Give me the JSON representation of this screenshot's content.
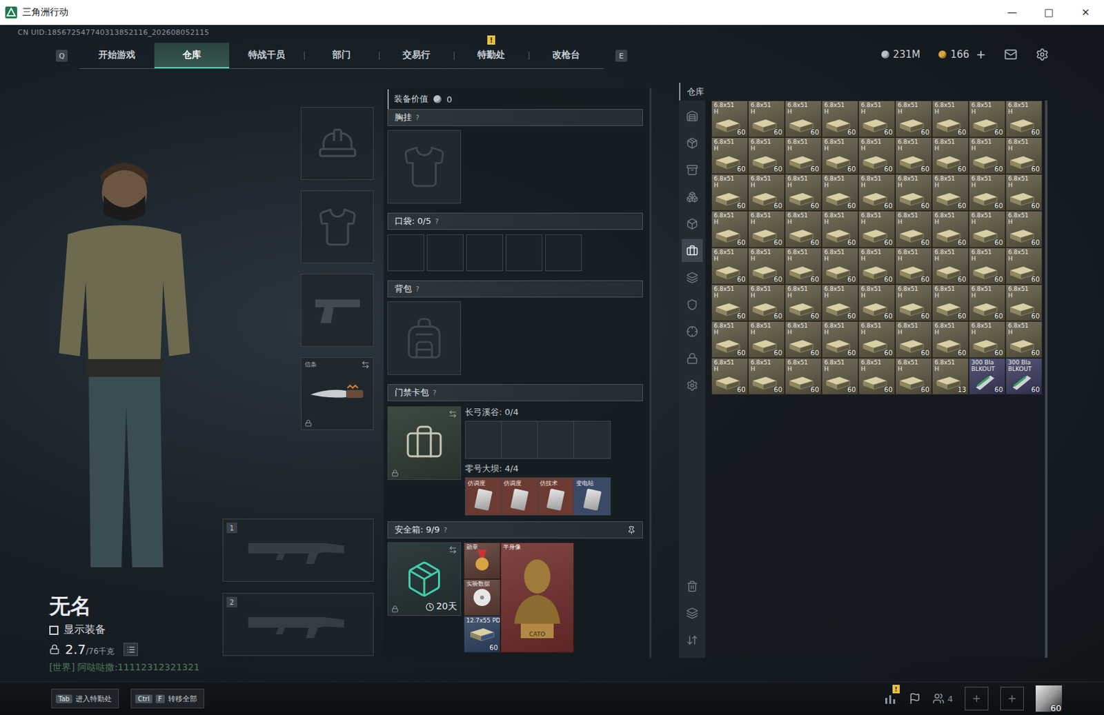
{
  "window": {
    "title": "三角洲行动",
    "controls": [
      "—",
      "□",
      "✕"
    ]
  },
  "uid": "CN UID:185672547740313852116_202608052115",
  "nav": {
    "prev_key": "Q",
    "next_key": "E",
    "tabs": [
      {
        "label": "开始游戏",
        "selected": false,
        "badge": ""
      },
      {
        "label": "仓库",
        "selected": true,
        "badge": ""
      },
      {
        "label": "特战干员",
        "selected": false,
        "badge": ""
      },
      {
        "label": "部门",
        "selected": false,
        "badge": ""
      },
      {
        "label": "交易行",
        "selected": false,
        "badge": ""
      },
      {
        "label": "特勤处",
        "selected": false,
        "badge": "!"
      },
      {
        "label": "改枪台",
        "selected": false,
        "badge": ""
      }
    ]
  },
  "currency": [
    {
      "amount": "231M",
      "color": "#b9bec4",
      "plus": ""
    },
    {
      "amount": "166",
      "color": "#d9a441",
      "plus": "+"
    }
  ],
  "player": {
    "name": "无名",
    "show_equipment": {
      "label": "显示装备",
      "checked": false
    },
    "weight": "2.7",
    "weight_max": "/76千克"
  },
  "chat": {
    "channel": "[世界]",
    "text": "阿哒哒撒:11112312321321"
  },
  "gear": {
    "slots": [
      {
        "kind": "helmet",
        "label": "",
        "locked": false
      },
      {
        "kind": "armor",
        "label": "",
        "locked": false
      },
      {
        "kind": "pistol",
        "label": "",
        "locked": false
      },
      {
        "kind": "melee",
        "label": "信条",
        "locked": true
      }
    ],
    "weapons": [
      {
        "number": "1"
      },
      {
        "number": "2"
      }
    ]
  },
  "loadout": {
    "value_label": "装备价值",
    "value": "0",
    "chest": {
      "title": "胸挂",
      "help": "?"
    },
    "pockets": {
      "title": "口袋: 0/5",
      "help": "?",
      "slots": [
        {
          "filled": false
        },
        {
          "filled": false
        },
        {
          "filled": false
        },
        {
          "filled": false
        },
        {
          "filled": false
        }
      ]
    },
    "backpack": {
      "title": "背包",
      "help": "?"
    },
    "keycards": {
      "title": "门禁卡包",
      "help": "?",
      "locked": true,
      "maps": [
        {
          "name": "长弓溪谷: 0/4",
          "cards": [
            {
              "filled": false,
              "label": "",
              "color": "#252c32"
            },
            {
              "filled": false,
              "label": "",
              "color": "#252c32"
            },
            {
              "filled": false,
              "label": "",
              "color": "#252c32"
            },
            {
              "filled": false,
              "label": "",
              "color": "#252c32"
            }
          ]
        },
        {
          "name": "零号大坝: 4/4",
          "cards": [
            {
              "filled": true,
              "label": "仿调度",
              "color": "#6b3a32"
            },
            {
              "filled": true,
              "label": "仿调度",
              "color": "#6b3a32"
            },
            {
              "filled": true,
              "label": "仿技术",
              "color": "#6b3a32"
            },
            {
              "filled": true,
              "label": "变电站",
              "color": "#3a4a66"
            }
          ]
        }
      ]
    },
    "safebox": {
      "title": "安全箱: 9/9",
      "help": "?",
      "timer": "20天",
      "locked": true,
      "items": [
        {
          "label": "勋章",
          "count": "",
          "kind": "small",
          "color": "#5b3b33",
          "caption": ""
        },
        {
          "label": "半身像",
          "count": "",
          "kind": "bust",
          "color": "#6e2b2b",
          "caption": "CATO"
        },
        {
          "label": "实验数据",
          "count": "",
          "kind": "small",
          "color": "#5b3b33",
          "caption": ""
        },
        {
          "label": "12.7x55 PD",
          "count": "60",
          "kind": "small",
          "color": "#2e4160",
          "caption": ""
        }
      ]
    }
  },
  "warehouse": {
    "title": "仓库",
    "sidebar": {
      "top": [
        {
          "selected": false
        },
        {
          "selected": false
        },
        {
          "selected": false
        },
        {
          "selected": false
        },
        {
          "selected": false
        },
        {
          "selected": true
        },
        {
          "selected": false
        },
        {
          "selected": false
        },
        {
          "selected": false
        },
        {
          "selected": false
        },
        {
          "selected": false
        }
      ],
      "bottom": [
        {
          "selected": false
        },
        {
          "selected": false
        },
        {
          "selected": false
        }
      ]
    },
    "items": [
      {
        "name": "6.8x51",
        "sub": "H",
        "count": "60",
        "color": "#5e5842",
        "kind": "box"
      },
      {
        "name": "6.8x51",
        "sub": "H",
        "count": "60",
        "color": "#5e5842",
        "kind": "box"
      },
      {
        "name": "6.8x51",
        "sub": "H",
        "count": "60",
        "color": "#5e5842",
        "kind": "box"
      },
      {
        "name": "6.8x51",
        "sub": "H",
        "count": "60",
        "color": "#5e5842",
        "kind": "box"
      },
      {
        "name": "6.8x51",
        "sub": "H",
        "count": "60",
        "color": "#5e5842",
        "kind": "box"
      },
      {
        "name": "6.8x51",
        "sub": "H",
        "count": "60",
        "color": "#5e5842",
        "kind": "box"
      },
      {
        "name": "6.8x51",
        "sub": "H",
        "count": "60",
        "color": "#5e5842",
        "kind": "box"
      },
      {
        "name": "6.8x51",
        "sub": "H",
        "count": "60",
        "color": "#5e5842",
        "kind": "box"
      },
      {
        "name": "6.8x51",
        "sub": "H",
        "count": "60",
        "color": "#5e5842",
        "kind": "box"
      },
      {
        "name": "6.8x51",
        "sub": "H",
        "count": "60",
        "color": "#5e5842",
        "kind": "box"
      },
      {
        "name": "6.8x51",
        "sub": "H",
        "count": "60",
        "color": "#5e5842",
        "kind": "box"
      },
      {
        "name": "6.8x51",
        "sub": "H",
        "count": "60",
        "color": "#5e5842",
        "kind": "box"
      },
      {
        "name": "6.8x51",
        "sub": "H",
        "count": "60",
        "color": "#5e5842",
        "kind": "box"
      },
      {
        "name": "6.8x51",
        "sub": "H",
        "count": "60",
        "color": "#5e5842",
        "kind": "box"
      },
      {
        "name": "6.8x51",
        "sub": "H",
        "count": "60",
        "color": "#5e5842",
        "kind": "box"
      },
      {
        "name": "6.8x51",
        "sub": "H",
        "count": "60",
        "color": "#5e5842",
        "kind": "box"
      },
      {
        "name": "6.8x51",
        "sub": "H",
        "count": "60",
        "color": "#5e5842",
        "kind": "box"
      },
      {
        "name": "6.8x51",
        "sub": "H",
        "count": "60",
        "color": "#5e5842",
        "kind": "box"
      },
      {
        "name": "6.8x51",
        "sub": "H",
        "count": "60",
        "color": "#5e5842",
        "kind": "box"
      },
      {
        "name": "6.8x51",
        "sub": "H",
        "count": "60",
        "color": "#5e5842",
        "kind": "box"
      },
      {
        "name": "6.8x51",
        "sub": "H",
        "count": "60",
        "color": "#5e5842",
        "kind": "box"
      },
      {
        "name": "6.8x51",
        "sub": "H",
        "count": "60",
        "color": "#5e5842",
        "kind": "box"
      },
      {
        "name": "6.8x51",
        "sub": "H",
        "count": "60",
        "color": "#5e5842",
        "kind": "box"
      },
      {
        "name": "6.8x51",
        "sub": "H",
        "count": "60",
        "color": "#5e5842",
        "kind": "box"
      },
      {
        "name": "6.8x51",
        "sub": "H",
        "count": "60",
        "color": "#5e5842",
        "kind": "box"
      },
      {
        "name": "6.8x51",
        "sub": "H",
        "count": "60",
        "color": "#5e5842",
        "kind": "box"
      },
      {
        "name": "6.8x51",
        "sub": "H",
        "count": "60",
        "color": "#5e5842",
        "kind": "box"
      },
      {
        "name": "6.8x51",
        "sub": "H",
        "count": "60",
        "color": "#5e5842",
        "kind": "box"
      },
      {
        "name": "6.8x51",
        "sub": "H",
        "count": "60",
        "color": "#5e5842",
        "kind": "box"
      },
      {
        "name": "6.8x51",
        "sub": "H",
        "count": "60",
        "color": "#5e5842",
        "kind": "box"
      },
      {
        "name": "6.8x51",
        "sub": "H",
        "count": "60",
        "color": "#5e5842",
        "kind": "box"
      },
      {
        "name": "6.8x51",
        "sub": "H",
        "count": "60",
        "color": "#5e5842",
        "kind": "box"
      },
      {
        "name": "6.8x51",
        "sub": "H",
        "count": "60",
        "color": "#5e5842",
        "kind": "box"
      },
      {
        "name": "6.8x51",
        "sub": "H",
        "count": "60",
        "color": "#5e5842",
        "kind": "box"
      },
      {
        "name": "6.8x51",
        "sub": "H",
        "count": "60",
        "color": "#5e5842",
        "kind": "box"
      },
      {
        "name": "6.8x51",
        "sub": "H",
        "count": "60",
        "color": "#5e5842",
        "kind": "box"
      },
      {
        "name": "6.8x51",
        "sub": "H",
        "count": "60",
        "color": "#5e5842",
        "kind": "box"
      },
      {
        "name": "6.8x51",
        "sub": "H",
        "count": "60",
        "color": "#5e5842",
        "kind": "box"
      },
      {
        "name": "6.8x51",
        "sub": "H",
        "count": "60",
        "color": "#5e5842",
        "kind": "box"
      },
      {
        "name": "6.8x51",
        "sub": "H",
        "count": "60",
        "color": "#5e5842",
        "kind": "box"
      },
      {
        "name": "6.8x51",
        "sub": "H",
        "count": "60",
        "color": "#5e5842",
        "kind": "box"
      },
      {
        "name": "6.8x51",
        "sub": "H",
        "count": "60",
        "color": "#5e5842",
        "kind": "box"
      },
      {
        "name": "6.8x51",
        "sub": "H",
        "count": "60",
        "color": "#5e5842",
        "kind": "box"
      },
      {
        "name": "6.8x51",
        "sub": "H",
        "count": "60",
        "color": "#5e5842",
        "kind": "box"
      },
      {
        "name": "6.8x51",
        "sub": "H",
        "count": "60",
        "color": "#5e5842",
        "kind": "box"
      },
      {
        "name": "6.8x51",
        "sub": "H",
        "count": "60",
        "color": "#5e5842",
        "kind": "box"
      },
      {
        "name": "6.8x51",
        "sub": "H",
        "count": "60",
        "color": "#5e5842",
        "kind": "box"
      },
      {
        "name": "6.8x51",
        "sub": "H",
        "count": "60",
        "color": "#5e5842",
        "kind": "box"
      },
      {
        "name": "6.8x51",
        "sub": "H",
        "count": "60",
        "color": "#5e5842",
        "kind": "box"
      },
      {
        "name": "6.8x51",
        "sub": "H",
        "count": "60",
        "color": "#5e5842",
        "kind": "box"
      },
      {
        "name": "6.8x51",
        "sub": "H",
        "count": "60",
        "color": "#5e5842",
        "kind": "box"
      },
      {
        "name": "6.8x51",
        "sub": "H",
        "count": "60",
        "color": "#5e5842",
        "kind": "box"
      },
      {
        "name": "6.8x51",
        "sub": "H",
        "count": "60",
        "color": "#5e5842",
        "kind": "box"
      },
      {
        "name": "6.8x51",
        "sub": "H",
        "count": "60",
        "color": "#5e5842",
        "kind": "box"
      },
      {
        "name": "6.8x51",
        "sub": "H",
        "count": "60",
        "color": "#5e5842",
        "kind": "box"
      },
      {
        "name": "6.8x51",
        "sub": "H",
        "count": "60",
        "color": "#5e5842",
        "kind": "box"
      },
      {
        "name": "6.8x51",
        "sub": "H",
        "count": "60",
        "color": "#5e5842",
        "kind": "box"
      },
      {
        "name": "6.8x51",
        "sub": "H",
        "count": "60",
        "color": "#5e5842",
        "kind": "box"
      },
      {
        "name": "6.8x51",
        "sub": "H",
        "count": "60",
        "color": "#5e5842",
        "kind": "box"
      },
      {
        "name": "6.8x51",
        "sub": "H",
        "count": "60",
        "color": "#5e5842",
        "kind": "box"
      },
      {
        "name": "6.8x51",
        "sub": "H",
        "count": "60",
        "color": "#5e5842",
        "kind": "box"
      },
      {
        "name": "6.8x51",
        "sub": "H",
        "count": "60",
        "color": "#5e5842",
        "kind": "box"
      },
      {
        "name": "6.8x51",
        "sub": "H",
        "count": "60",
        "color": "#5e5842",
        "kind": "box"
      },
      {
        "name": "6.8x51",
        "sub": "H",
        "count": "60",
        "color": "#5e5842",
        "kind": "box"
      },
      {
        "name": "6.8x51",
        "sub": "H",
        "count": "60",
        "color": "#5e5842",
        "kind": "box"
      },
      {
        "name": "6.8x51",
        "sub": "H",
        "count": "60",
        "color": "#5e5842",
        "kind": "box"
      },
      {
        "name": "6.8x51",
        "sub": "H",
        "count": "60",
        "color": "#5e5842",
        "kind": "box"
      },
      {
        "name": "6.8x51",
        "sub": "H",
        "count": "60",
        "color": "#5e5842",
        "kind": "box"
      },
      {
        "name": "6.8x51",
        "sub": "H",
        "count": "60",
        "color": "#5e5842",
        "kind": "box"
      },
      {
        "name": "6.8x51",
        "sub": "H",
        "count": "13",
        "color": "#5e5842",
        "kind": "box"
      },
      {
        "name": "300 Bla",
        "sub": "BLKOUT",
        "count": "60",
        "color": "#3a3c5e",
        "kind": "mag"
      },
      {
        "name": "300 Bla",
        "sub": "BLKOUT",
        "count": "60",
        "color": "#3a3c5e",
        "kind": "mag"
      }
    ]
  },
  "bottom": {
    "hints": [
      {
        "keys": [
          "Tab"
        ],
        "label": "进入特勤处"
      },
      {
        "keys": [
          "Ctrl",
          "F"
        ],
        "label": "转移全部"
      }
    ],
    "alert": "!",
    "friends": "4",
    "party_slots": [
      {
        "filled": false
      },
      {
        "filled": false
      }
    ],
    "level": "60"
  }
}
